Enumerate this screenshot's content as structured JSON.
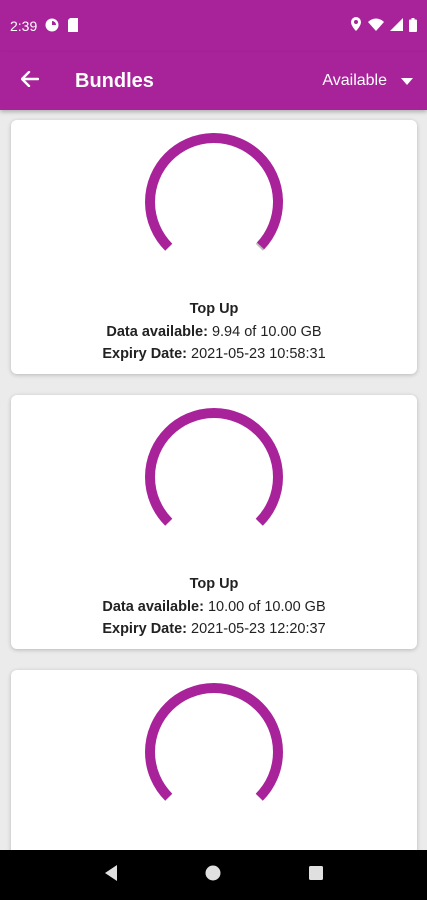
{
  "status_bar": {
    "time": "2:39",
    "icons": [
      "notification-icon",
      "sim-card-icon",
      "location-icon",
      "wifi-icon",
      "signal-icon",
      "battery-icon"
    ]
  },
  "app_bar": {
    "title": "Bundles",
    "filter_value": "Available",
    "icons": [
      "back-arrow-icon",
      "dropdown-arrow-icon"
    ]
  },
  "bundles": [
    {
      "title": "Top Up",
      "data_label": "Data available:",
      "data_value": "9.94 of 10.00 GB",
      "expiry_label": "Expiry Date:",
      "expiry_value": "2021-05-23 10:58:31",
      "remaining_fraction": 0.994
    },
    {
      "title": "Top Up",
      "data_label": "Data available:",
      "data_value": "10.00 of 10.00 GB",
      "expiry_label": "Expiry Date:",
      "expiry_value": "2021-05-23 12:20:37",
      "remaining_fraction": 1.0
    },
    {
      "title": "",
      "data_label": "",
      "data_value": "",
      "expiry_label": "",
      "expiry_value": "",
      "remaining_fraction": 1.0
    }
  ],
  "colors": {
    "brand": "#a8229a",
    "gauge_used": "#bdbdbd",
    "background": "#ebebeb",
    "nav_bar": "#000000"
  },
  "nav_bar": {
    "icons": [
      "back-triangle-icon",
      "home-circle-icon",
      "recents-square-icon"
    ]
  }
}
